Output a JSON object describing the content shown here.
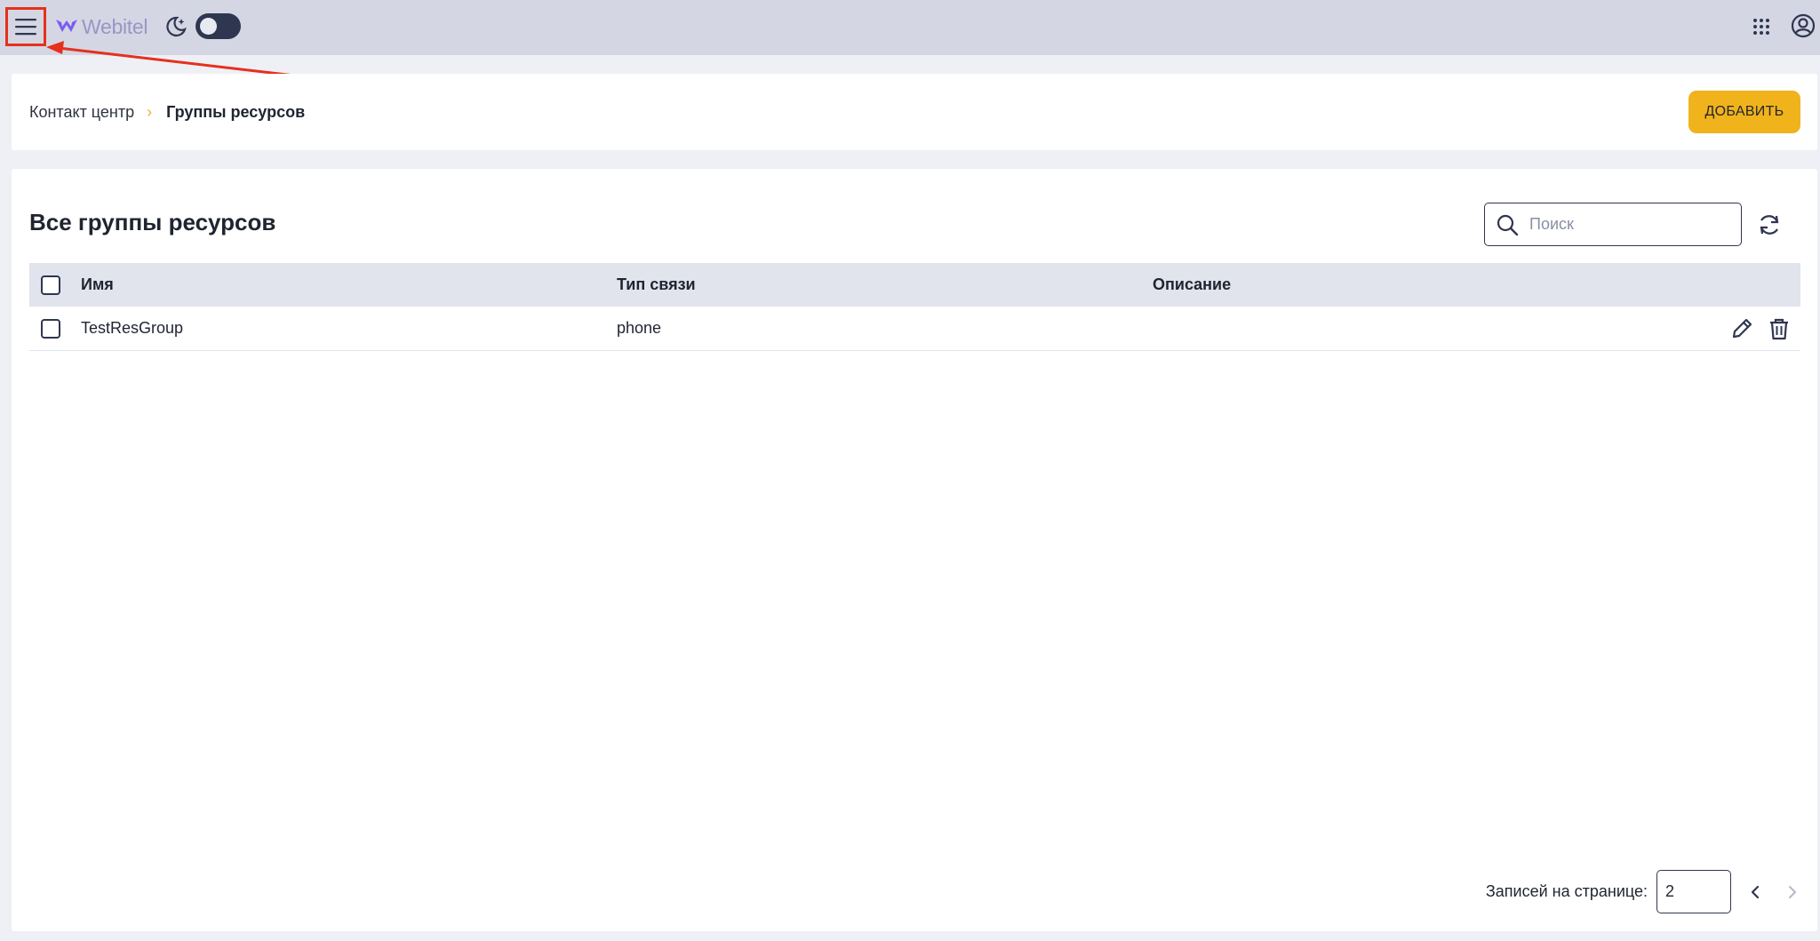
{
  "header": {
    "logo_text": "Webitel",
    "icons": {
      "menu": "hamburger-menu-icon",
      "theme": "moon-stars-icon",
      "apps": "grid-dots-icon",
      "account": "account-circle-icon"
    },
    "colors": {
      "bar": "#d4d7e3",
      "highlight": "#e6301d"
    }
  },
  "breadcrumb": {
    "root": "Контакт центр",
    "separator": "›",
    "current": "Группы ресурсов"
  },
  "toolbar": {
    "add_label": "ДОБАВИТЬ",
    "add_color": "#f0b31b"
  },
  "main": {
    "title": "Все группы ресурсов",
    "search": {
      "placeholder": "Поиск",
      "value": ""
    },
    "table": {
      "columns": [
        "Имя",
        "Тип связи",
        "Описание"
      ],
      "rows": [
        {
          "name": "TestResGroup",
          "type": "phone",
          "description": ""
        }
      ]
    },
    "pagination": {
      "label": "Записей на странице:",
      "per_page": "2"
    }
  }
}
